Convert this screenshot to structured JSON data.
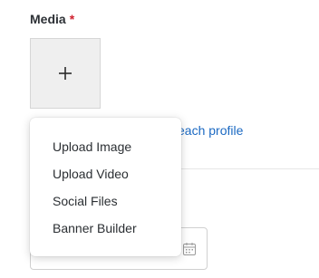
{
  "field": {
    "label": "Media",
    "required_mark": "*"
  },
  "upload": {
    "icon": "plus-icon"
  },
  "link": {
    "partial_text": "each profile"
  },
  "menu": {
    "items": [
      {
        "label": "Upload Image"
      },
      {
        "label": "Upload Video"
      },
      {
        "label": "Social Files"
      },
      {
        "label": "Banner Builder"
      }
    ]
  },
  "date_field": {
    "icon": "calendar-icon"
  },
  "colors": {
    "required": "#d0212f",
    "link": "#1b69c2",
    "upload_bg": "#efefef"
  }
}
